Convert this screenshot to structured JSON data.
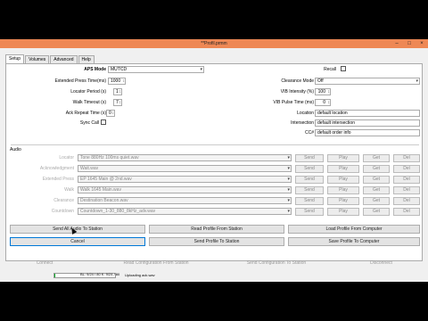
{
  "window": {
    "title": "**Profil.prmm"
  },
  "tabs": [
    "Setup",
    "Volumes",
    "Advanced",
    "Help"
  ],
  "setup": {
    "aps_mode": {
      "label": "APS Mode",
      "value": "MUTCD"
    },
    "extended_press": {
      "label": "Extended Press Time(ms)",
      "value": "1000"
    },
    "locator_period": {
      "label": "Locator Period (s)",
      "value": "1"
    },
    "walk_timeout": {
      "label": "Walk Timeout (s)",
      "value": "7"
    },
    "ack_repeat": {
      "label": "Ack Repeat Time (s)",
      "value": "0"
    },
    "sync_call": {
      "label": "Sync Call"
    },
    "recall": {
      "label": "Recall"
    },
    "clearance_mode": {
      "label": "Clearance Mode",
      "value": "Off"
    },
    "vib_intensity": {
      "label": "VIB Intensity (%)",
      "value": "100"
    },
    "vib_pulse": {
      "label": "VIB Pulse Time (ms)",
      "value": "0"
    },
    "location": {
      "label": "Location",
      "value": "default location"
    },
    "intersection": {
      "label": "Intersection",
      "value": "default intersection"
    },
    "cc": {
      "label": "CC#",
      "value": "default order info"
    }
  },
  "audio": {
    "section_label": "Audio",
    "rows": [
      {
        "label": "Locator",
        "file": "Tone 880Hz 100ms quiet.wav"
      },
      {
        "label": "Acknowledgment",
        "file": "Wait.wav"
      },
      {
        "label": "Extended Press",
        "file": "EP 1645 Main @ 2nd.wav"
      },
      {
        "label": "Walk",
        "file": "Walk 1645 Main.wav"
      },
      {
        "label": "Clearance",
        "file": "Destination Beacon.wav"
      },
      {
        "label": "Countdown",
        "file": "Countdown_1-30_880_8kHz_adv.wav"
      }
    ],
    "row_buttons": {
      "send": "Send",
      "play": "Play",
      "get": "Get",
      "del": "Del"
    }
  },
  "actions": {
    "send_all_audio": "Send All Audio To Station",
    "read_profile": "Read Profile From Station",
    "load_profile": "Load Profile From Computer",
    "cancel": "Cancel",
    "send_profile": "Send Profile To Station",
    "save_profile": "Save Profile To Computer"
  },
  "status_bar": {
    "connect": "Connect",
    "read_config": "Read Configuration From Station",
    "send_config": "Send Configuration To Station",
    "disconnect": "Disconnect",
    "progress_text": "BL: 9/24 / 80 K: 9/24 / 80",
    "progress_fraction": 0.02,
    "message": "Uploading ack.wav"
  }
}
